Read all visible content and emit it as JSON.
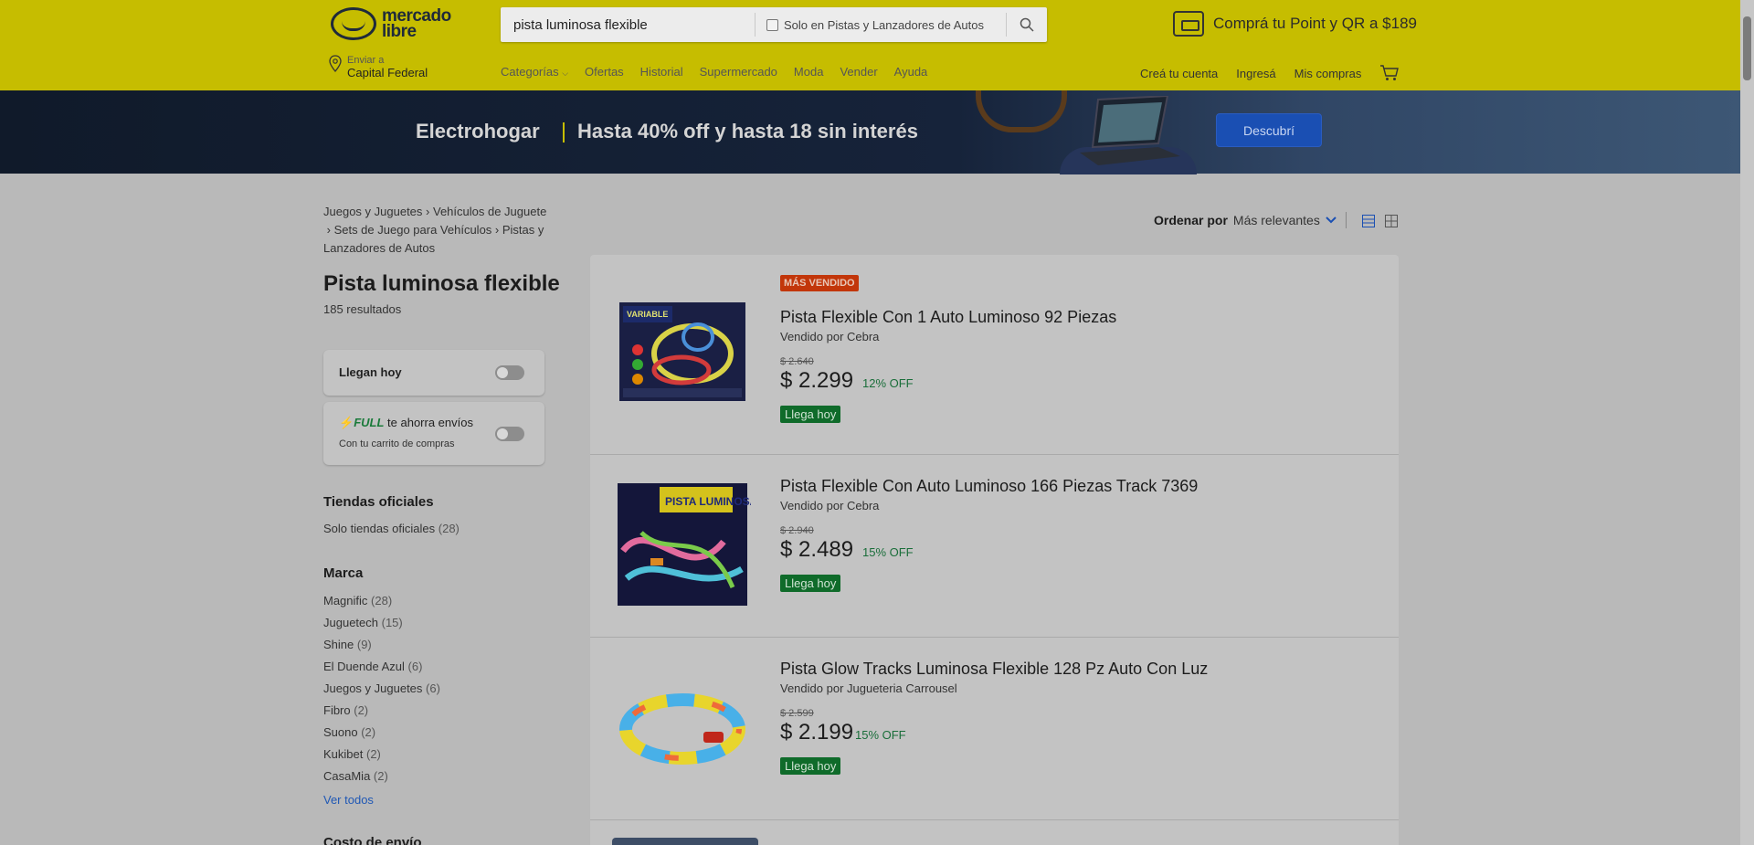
{
  "header": {
    "logo_line1": "mercado",
    "logo_line2": "libre",
    "search_value": "pista luminosa flexible",
    "search_checkbox_label": "Solo en Pistas y Lanzadores de Autos",
    "promo_text": "Comprá tu Point y QR a $189",
    "location_small": "Enviar a",
    "location_big": "Capital Federal",
    "nav": [
      "Categorías",
      "Ofertas",
      "Historial",
      "Supermercado",
      "Moda",
      "Vender",
      "Ayuda"
    ],
    "nav_right": [
      "Creá tu cuenta",
      "Ingresá",
      "Mis compras"
    ],
    "accent": "#c6bd00"
  },
  "banner": {
    "title": "Electrohogar",
    "subtitle": "Hasta 40% off y hasta 18 sin interés",
    "button": "Descubrí"
  },
  "sidebar": {
    "breadcrumb": {
      "c1": "Juegos y Juguetes",
      "c2": "Vehículos de Juguete",
      "c3": "Sets de Juego para Vehículos",
      "c4a": "Pistas y",
      "c4b": "Lanzadores de Autos"
    },
    "title": "Pista luminosa flexible",
    "results": "185 resultados",
    "llegan_hoy": "Llegan hoy",
    "full_label": "FULL",
    "full_text": "te ahorra envíos",
    "full_small": "Con tu carrito de compras",
    "tiendas_title": "Tiendas oficiales",
    "tiendas_item": "Solo tiendas oficiales",
    "tiendas_count": "(28)",
    "marca_title": "Marca",
    "marcas": [
      {
        "name": "Magnific",
        "count": "(28)"
      },
      {
        "name": "Juguetech",
        "count": "(15)"
      },
      {
        "name": "Shine",
        "count": "(9)"
      },
      {
        "name": "El Duende Azul",
        "count": "(6)"
      },
      {
        "name": "Juegos y Juguetes",
        "count": "(6)"
      },
      {
        "name": "Fibro",
        "count": "(2)"
      },
      {
        "name": "Suono",
        "count": "(2)"
      },
      {
        "name": "Kukibet",
        "count": "(2)"
      },
      {
        "name": "CasaMia",
        "count": "(2)"
      }
    ],
    "ver_todos": "Ver todos",
    "costo_title": "Costo de envío"
  },
  "sort": {
    "label": "Ordenar por",
    "value": "Más relevantes"
  },
  "results": [
    {
      "badge": "MÁS VENDIDO",
      "title": "Pista Flexible Con 1 Auto Luminoso 92 Piezas",
      "seller": "Vendido por Cebra",
      "old_price": "$ 2.640",
      "price": "$ 2.299",
      "off": "12% OFF",
      "arrives": "Llega hoy",
      "box_label": "VARIABLE"
    },
    {
      "title": "Pista Flexible Con Auto Luminoso 166 Piezas Track 7369",
      "seller": "Vendido por Cebra",
      "old_price": "$ 2.940",
      "price": "$ 2.489",
      "off": "15% OFF",
      "arrives": "Llega hoy",
      "box_label": "PISTA LUMINOSA"
    },
    {
      "title": "Pista Glow Tracks Luminosa Flexible 128 Pz Auto Con Luz",
      "seller": "Vendido por Jugueteria Carrousel",
      "old_price": "$ 2.599",
      "price": "$ 2.199",
      "off": "15% OFF",
      "arrives": "Llega hoy"
    }
  ]
}
